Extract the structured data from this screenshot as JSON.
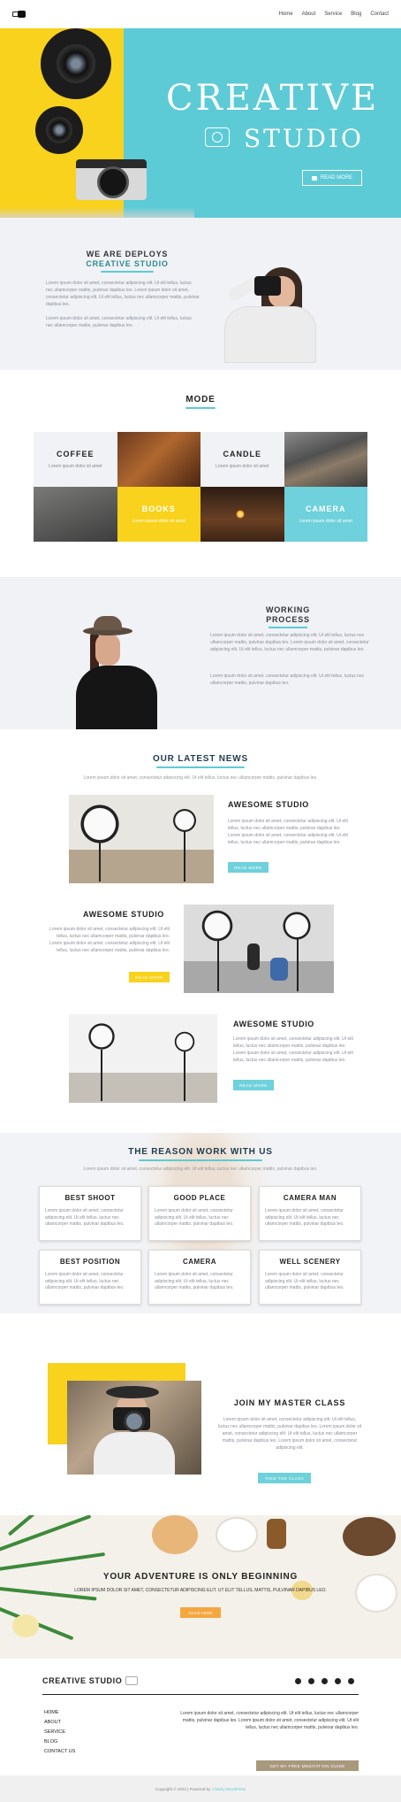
{
  "nav": {
    "links": [
      "Home",
      "About",
      "Service",
      "Blog",
      "Contact"
    ]
  },
  "hero": {
    "title_line1": "CREATIVE",
    "title_line2": "STUDIO",
    "button": "READ MORE"
  },
  "about": {
    "heading_line1": "WE ARE DEPLOYS",
    "heading_line2": "CREATIVE STUDIO",
    "para1": "Lorem ipsum dolor sit amet, consectetur adipiscing elit. Ut elit tellus, luctus nec ullamcorper mattis, pulvinar dapibus leo. Lorem ipsum dolor sit amet, consectetur adipiscing elit. Ut elit tellus, luctus nec ullamcorper mattis, pulvinar dapibus leo.",
    "para2": "Lorem ipsum dolor sit amet, consectetur adipiscing elit. Ut elit tellus, luctus nec ullamcorper mattis, pulvinar dapibus leo."
  },
  "mode": {
    "title": "MODE",
    "tiles": [
      {
        "title": "COFFEE",
        "text": "Lorem ipsum dolor sit amet"
      },
      {
        "title": "CANDLE",
        "text": "Lorem ipsum dolor sit amet"
      },
      {
        "title": "BOOKS",
        "text": "Lorem ipsum dolor sit amet"
      },
      {
        "title": "CAMERA",
        "text": "Lorem ipsum dolor sit amet"
      }
    ]
  },
  "work": {
    "heading_line1": "WORKING",
    "heading_line2": "PROCESS",
    "para1": "Lorem ipsum dolor sit amet, consectetur adipiscing elit. Ut elit tellus, luctus nec ullamcorper mattis, pulvinar dapibus leo. Lorem ipsum dolor sit amet, consectetur adipiscing elit. Ut elit tellus, luctus nec ullamcorper mattis, pulvinar dapibus leo.",
    "para2": "Lorem ipsum dolor sit amet, consectetur adipiscing elit. Ut elit tellus, luctus nec ullamcorper mattis, pulvinar dapibus leo."
  },
  "news": {
    "title": "OUR LATEST NEWS",
    "subtitle": "Lorem ipsum dolor sit amet, consectetur adipiscing elit. Ut elit tellus, luctus nec ullamcorper mattis, pulvinar dapibus leo.",
    "items": [
      {
        "title": "AWESOME STUDIO",
        "text": "Lorem ipsum dolor sit amet, consectetur adipiscing elit. Ut elit tellus, luctus nec ullamcorper mattis, pulvinar dapibus leo. Lorem ipsum dolor sit amet, consectetur adipiscing elit. Ut elit tellus, luctus nec ullamcorper mattis, pulvinar dapibus leo.",
        "button": "READ MORE"
      },
      {
        "title": "AWESOME STUDIO",
        "text": "Lorem ipsum dolor sit amet, consectetur adipiscing elit. Ut elit tellus, luctus nec ullamcorper mattis, pulvinar dapibus leo. Lorem ipsum dolor sit amet, consectetur adipiscing elit. Ut elit tellus, luctus nec ullamcorper mattis, pulvinar dapibus leo.",
        "button": "READ MORE"
      },
      {
        "title": "AWESOME STUDIO",
        "text": "Lorem ipsum dolor sit amet, consectetur adipiscing elit. Ut elit tellus, luctus nec ullamcorper mattis, pulvinar dapibus leo. Lorem ipsum dolor sit amet, consectetur adipiscing elit. Ut elit tellus, luctus nec ullamcorper mattis, pulvinar dapibus leo.",
        "button": "READ MORE"
      }
    ]
  },
  "reason": {
    "title": "THE REASON WORK WITH US",
    "subtitle": "Lorem ipsum dolor sit amet, consectetur adipiscing elit. Ut elit tellus, luctus nec ullamcorper mattis, pulvinar dapibus leo.",
    "cards": [
      {
        "title": "BEST SHOOT",
        "text": "Lorem ipsum dolor sit amet, consectetur adipiscing elit. Ut elit tellus, luctus nec ullamcorper mattis, pulvinar dapibus leo."
      },
      {
        "title": "GOOD PLACE",
        "text": "Lorem ipsum dolor sit amet, consectetur adipiscing elit. Ut elit tellus, luctus nec ullamcorper mattis, pulvinar dapibus leo."
      },
      {
        "title": "CAMERA MAN",
        "text": "Lorem ipsum dolor sit amet, consectetur adipiscing elit. Ut elit tellus, luctus nec ullamcorper mattis, pulvinar dapibus leo."
      },
      {
        "title": "BEST POSITION",
        "text": "Lorem ipsum dolor sit amet, consectetur adipiscing elit. Ut elit tellus, luctus nec ullamcorper mattis, pulvinar dapibus leo."
      },
      {
        "title": "CAMERA",
        "text": "Lorem ipsum dolor sit amet, consectetur adipiscing elit. Ut elit tellus, luctus nec ullamcorper mattis, pulvinar dapibus leo."
      },
      {
        "title": "WELL SCENERY",
        "text": "Lorem ipsum dolor sit amet, consectetur adipiscing elit. Ut elit tellus, luctus nec ullamcorper mattis, pulvinar dapibus leo."
      }
    ]
  },
  "master": {
    "title": "JOIN MY MASTER CLASS",
    "text": "Lorem ipsum dolor sit amet, consectetur adipiscing elit. Ut elit tellus, luctus nec ullamcorper mattis, pulvinar dapibus leo. Lorem ipsum dolor sit amet, consectetur adipiscing elit. Ut elit tellus, luctus nec ullamcorper mattis, pulvinar dapibus leo. Lorem ipsum dolor sit amet, consectetur adipiscing elit.",
    "button": "TAKE THE CLASS"
  },
  "adventure": {
    "title": "YOUR ADVENTURE IS ONLY BEGINNING",
    "text": "LOREM IPSUM DOLOR SIT AMET, CONSECTETUR ADIPISCING ELIT. UT ELIT TELLUS, MATTIS, PULVINAR DAPIBUS LEO.",
    "button": "CLICK HERE"
  },
  "footer": {
    "brand": "CREATIVE STUDIO",
    "links": [
      "HOME",
      "ABOUT",
      "SERVICE",
      "BLOG",
      "CONTACT US"
    ],
    "text": "Lorem ipsum dolor sit amet, consectetur adipiscing elit. Ut elit tellus, luctus nec ullamcorper mattis, pulvinar dapibus leo. Lorem ipsum dolor sit amet, consectetur adipiscing elit. Ut elit tellus, luctus nec ullamcorper mattis, pulvinar dapibus leo.",
    "button": "GET MY FREE MEDITATION GUIDE",
    "social_icons": [
      "facebook-icon",
      "twitter-icon",
      "youtube-icon",
      "instagram-icon",
      "linkedin-icon"
    ]
  },
  "copyright": {
    "text": "Copyright © 2022 | Powered by",
    "link": "Charity WordPress"
  },
  "colors": {
    "cyan": "#5ccbd6",
    "yellow": "#f8d21c",
    "orange": "#f4a63f",
    "gold": "#a8987c"
  }
}
